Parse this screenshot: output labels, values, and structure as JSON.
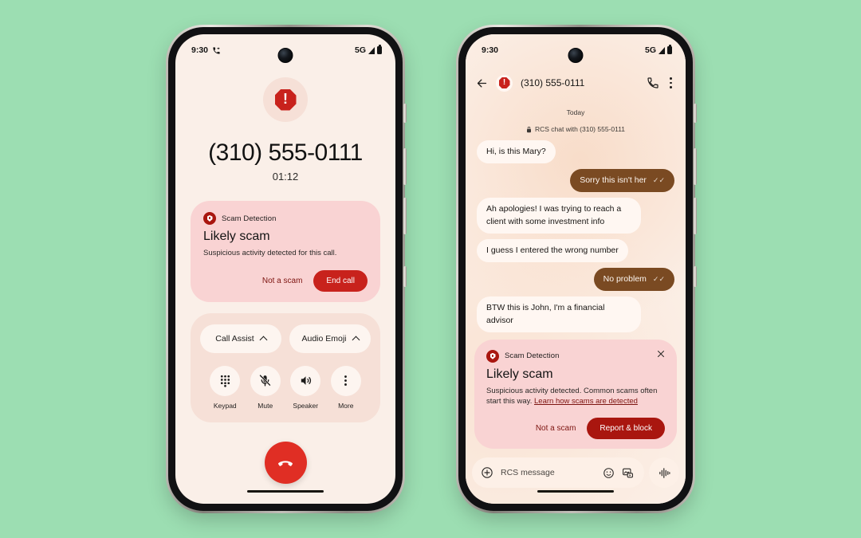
{
  "theme": {
    "page_background": "#9CDEB2",
    "screen_background": "#FAEFE8",
    "scam_card_background": "#F9D3D3",
    "danger_red": "#C8221C",
    "deep_red": "#A9160F",
    "outgoing_bubble": "#7A4A22",
    "incoming_bubble": "#FFF7F2"
  },
  "call_phone": {
    "status_bar": {
      "time": "9:30",
      "call_icon": "phone-forwarded-icon",
      "network": "5G",
      "signal_icon": "signal-bars-icon",
      "battery_icon": "battery-icon"
    },
    "warning_icon": "exclamation-octagon-icon",
    "warning_glyph": "!",
    "caller_number": "(310) 555-0111",
    "call_duration": "01:12",
    "scam_card": {
      "badge_icon": "shield-alert-icon",
      "label": "Scam Detection",
      "title": "Likely scam",
      "body": "Suspicious activity detected for this call.",
      "secondary_action": "Not a scam",
      "primary_action": "End call"
    },
    "controls": {
      "pills": [
        {
          "label": "Call Assist",
          "icon": "chevron-up-icon"
        },
        {
          "label": "Audio Emoji",
          "icon": "chevron-up-icon"
        }
      ],
      "buttons": [
        {
          "label": "Keypad",
          "icon": "dialpad-icon"
        },
        {
          "label": "Mute",
          "icon": "microphone-muted-icon"
        },
        {
          "label": "Speaker",
          "icon": "speaker-icon"
        },
        {
          "label": "More",
          "icon": "overflow-menu-icon"
        }
      ],
      "end_call_icon": "phone-hangup-icon"
    },
    "home_indicator": "home-indicator"
  },
  "messages_phone": {
    "status_bar": {
      "time": "9:30",
      "network": "5G",
      "signal_icon": "signal-bars-icon",
      "battery_icon": "battery-icon"
    },
    "app_bar": {
      "back_icon": "back-arrow-icon",
      "avatar_icon": "exclamation-octagon-icon",
      "avatar_glyph": "!",
      "title": "(310) 555-0111",
      "call_icon": "phone-icon",
      "menu_icon": "overflow-menu-icon"
    },
    "chat_meta": {
      "day": "Today",
      "lock_icon": "lock-icon",
      "encryption_note": "RCS chat with (310) 555-0111"
    },
    "messages": [
      {
        "direction": "in",
        "text": "Hi, is this Mary?"
      },
      {
        "direction": "out",
        "text": "Sorry this isn't her",
        "status": "✓✓"
      },
      {
        "direction": "in",
        "text": "Ah apologies! I was trying to reach a client with some investment info"
      },
      {
        "direction": "in",
        "text": "I guess I entered the wrong number"
      },
      {
        "direction": "out",
        "text": "No problem",
        "status": "✓✓"
      },
      {
        "direction": "in",
        "text": "BTW this is John, I'm a financial advisor"
      }
    ],
    "scam_card": {
      "badge_icon": "shield-alert-icon",
      "label": "Scam Detection",
      "close_icon": "close-icon",
      "title": "Likely scam",
      "body_prefix": "Suspicious activity detected. Common scams often start this way.",
      "link_text": "Learn how scams are detected",
      "secondary_action": "Not a scam",
      "primary_action": "Report & block"
    },
    "composer": {
      "add_icon": "plus-circle-icon",
      "placeholder": "RCS message",
      "emoji_icon": "emoji-icon",
      "media_icon": "gallery-icon",
      "voice_icon": "voice-waveform-icon"
    },
    "home_indicator": "home-indicator"
  }
}
